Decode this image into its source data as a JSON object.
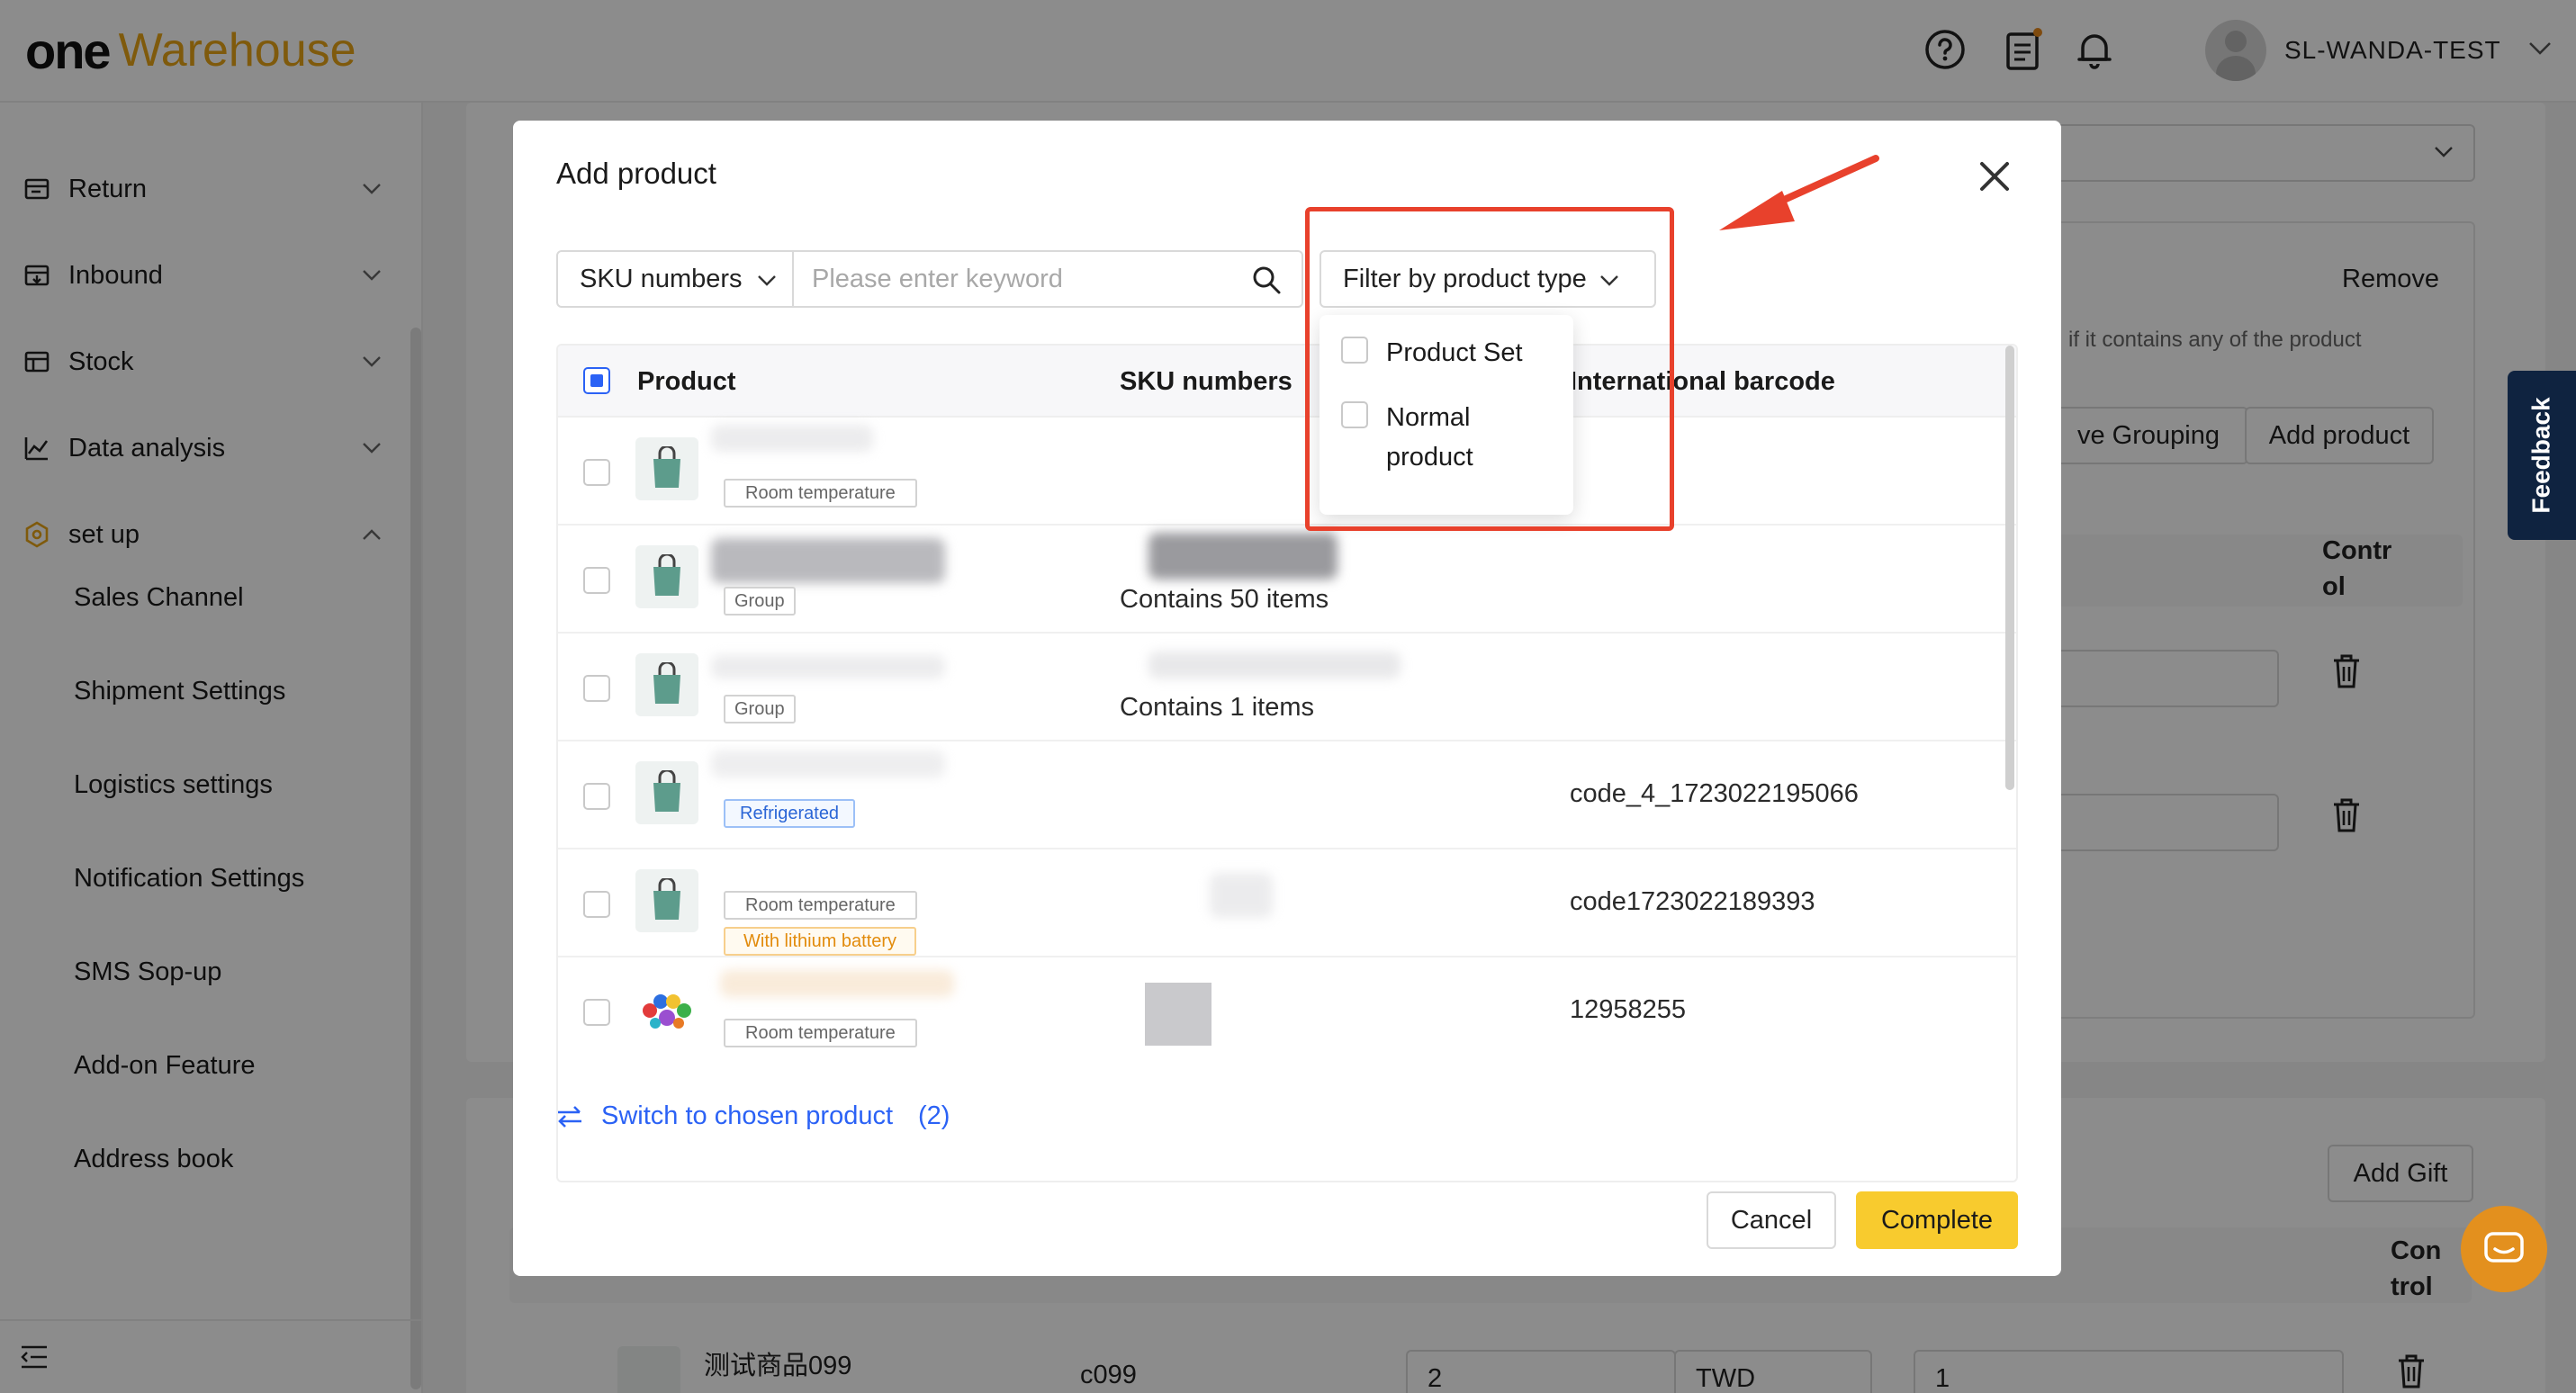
{
  "brand": {
    "one": "one",
    "warehouse": "Warehouse"
  },
  "header": {
    "user_name": "SL-WANDA-TEST",
    "icons": [
      "help-icon",
      "clipboard-icon",
      "bell-icon"
    ]
  },
  "sidebar": {
    "groups": [
      {
        "label": "Return",
        "icon": "return-icon"
      },
      {
        "label": "Inbound",
        "icon": "inbound-icon"
      },
      {
        "label": "Stock",
        "icon": "stock-icon"
      },
      {
        "label": "Data analysis",
        "icon": "chart-icon"
      },
      {
        "label": "set up",
        "icon": "hexagon-settings-icon"
      }
    ],
    "subitems": [
      "Sales Channel",
      "Shipment Settings",
      "Logistics settings",
      "Notification Settings",
      "SMS Sop-up",
      "Add-on Feature",
      "Address book"
    ]
  },
  "background": {
    "remove_label": "Remove",
    "hint_text": "if it contains any of the product",
    "grouping_label": "ve Grouping",
    "add_product_label": "Add product",
    "control_label": "Contr\nol",
    "add_gift_label": "Add Gift",
    "control2_label": "Con\ntrol",
    "row_name": "测试商品099",
    "row_sku": "c099",
    "row_qty": "2",
    "row_currency": "TWD",
    "row_price": "1"
  },
  "feedback_label": "Feedback",
  "modal": {
    "title": "Add product",
    "search_field_label": "SKU numbers",
    "search_placeholder": "Please enter keyword",
    "type_filter_label": "Filter by product type",
    "type_options": [
      "Product Set",
      "Normal product"
    ],
    "columns": {
      "product": "Product",
      "sku": "SKU numbers",
      "barcode": "International barcode"
    },
    "rows": [
      {
        "tags": [
          "Room temperature"
        ],
        "sku": "",
        "barcode": ""
      },
      {
        "tags": [
          "Group"
        ],
        "sku": "Contains 50 items",
        "barcode": ""
      },
      {
        "tags": [
          "Group"
        ],
        "sku": "Contains 1 items",
        "barcode": ""
      },
      {
        "tags": [
          "Refrigerated"
        ],
        "sku": "",
        "barcode": "code_4_1723022195066"
      },
      {
        "tags": [
          "Room temperature",
          "With lithium battery"
        ],
        "sku": "",
        "barcode": "code1723022189393"
      },
      {
        "tags": [
          "Room temperature"
        ],
        "sku": "",
        "barcode": "12958255"
      }
    ],
    "switch_link": "Switch to chosen product",
    "chosen_count": "(2)",
    "cancel_label": "Cancel",
    "complete_label": "Complete"
  }
}
